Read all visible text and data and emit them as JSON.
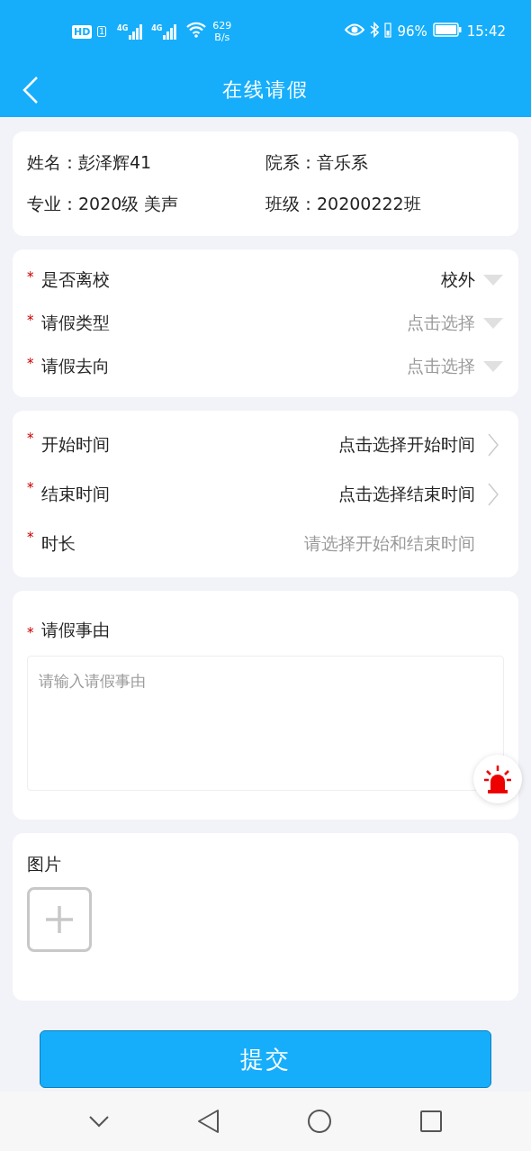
{
  "status_bar": {
    "hd": "HD",
    "sim": "1",
    "signals": [
      "4G",
      "4G"
    ],
    "speed": "629",
    "speed_unit": "B/s",
    "battery": "96%",
    "time": "15:42"
  },
  "header": {
    "title": "在线请假"
  },
  "student_info": [
    {
      "label": "姓名：",
      "value": "彭泽辉41"
    },
    {
      "label": "院系：",
      "value": "音乐系"
    },
    {
      "label": "专业：",
      "value": "2020级 美声"
    },
    {
      "label": "班级：",
      "value": "20200222班"
    }
  ],
  "leave_fields": [
    {
      "mark": "*",
      "label": "是否离校",
      "value": "校外",
      "kind": "dropdown"
    },
    {
      "mark": "*",
      "label": "请假类型",
      "placeholder": "点击选择",
      "kind": "dropdown"
    },
    {
      "mark": "*",
      "label": "请假去向",
      "placeholder": "点击选择",
      "kind": "dropdown"
    }
  ],
  "time_fields": [
    {
      "mark": "*",
      "label": "开始时间",
      "value": "点击选择开始时间",
      "kind": "link"
    },
    {
      "mark": "*",
      "label": "结束时间",
      "value": "点击选择结束时间",
      "kind": "link"
    },
    {
      "mark": "*",
      "label": "时长",
      "placeholder": "请选择开始和结束时间",
      "kind": "readout"
    }
  ],
  "reason": {
    "mark": "*",
    "label": "请假事由",
    "placeholder": "请输入请假事由"
  },
  "images": {
    "label": "图片"
  },
  "submit": "提交"
}
